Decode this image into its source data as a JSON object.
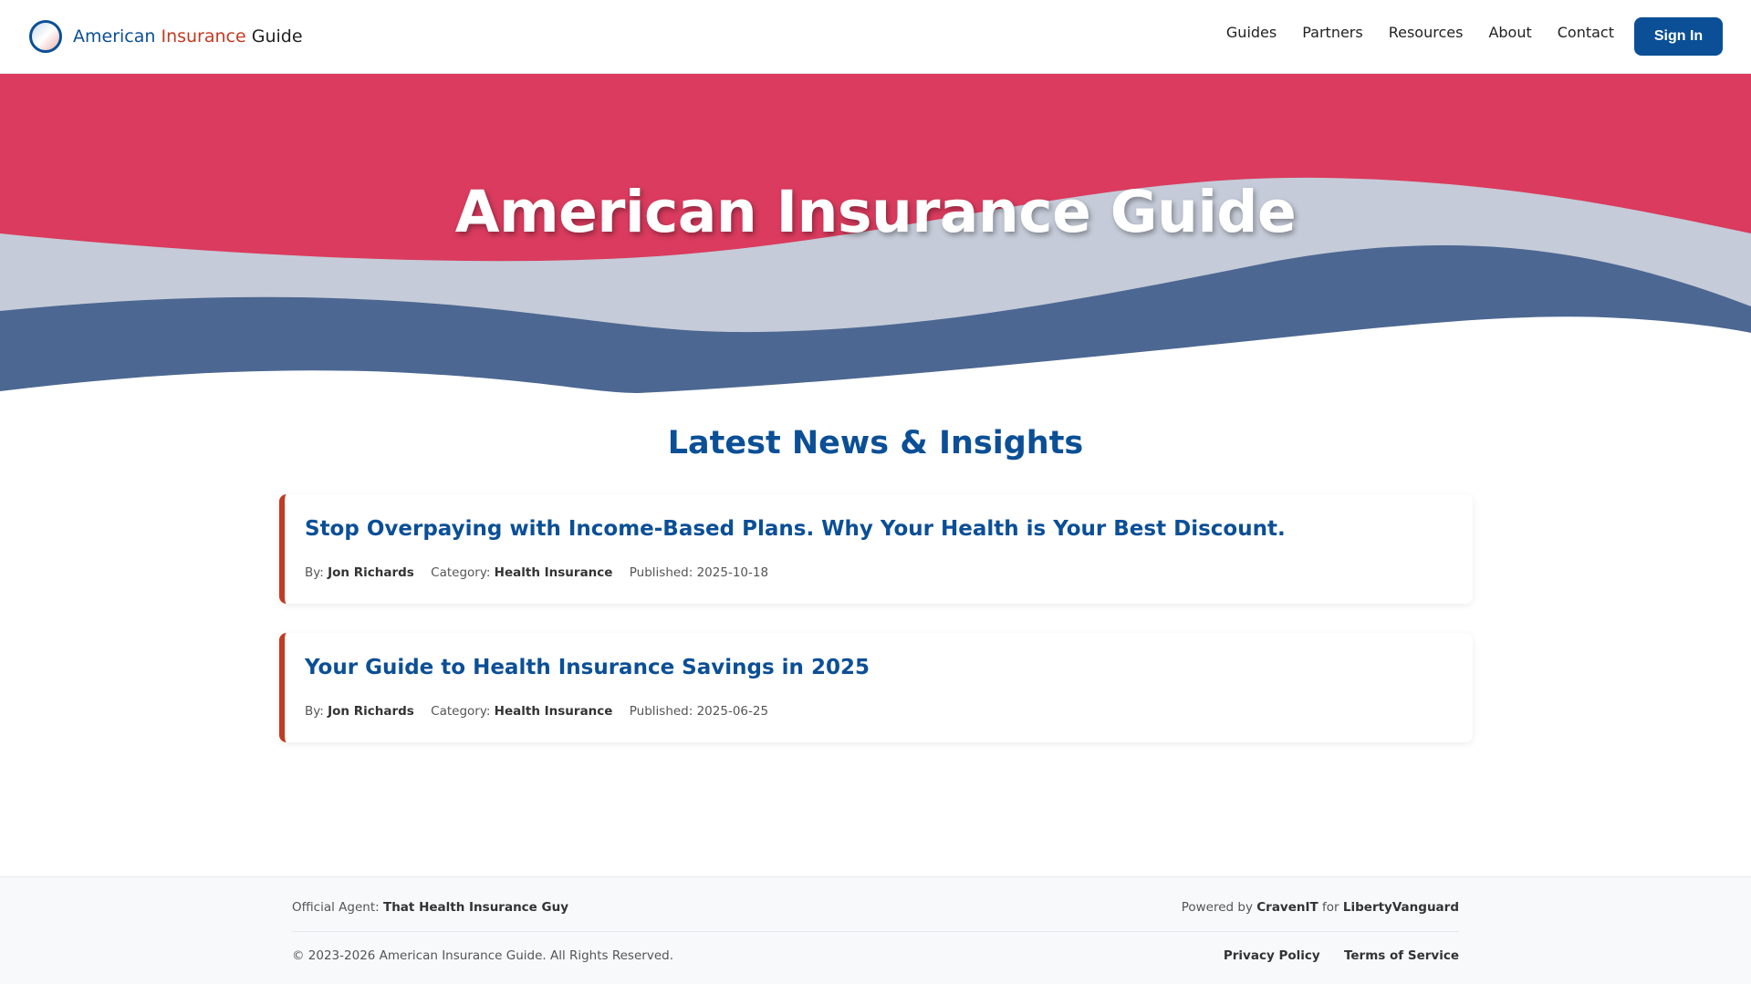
{
  "brand": {
    "word1": "American",
    "word2": "Insurance",
    "word3": "Guide",
    "colors": {
      "primary": "#0b4f96",
      "accent": "#c23a22",
      "hero_red": "#da3b5e",
      "hero_light": "#c5cbd8",
      "hero_blue": "#4c6792"
    }
  },
  "nav": {
    "items": [
      "Guides",
      "Partners",
      "Resources",
      "About",
      "Contact"
    ],
    "signin_label": "Sign In"
  },
  "hero": {
    "title": "American Insurance Guide"
  },
  "news": {
    "heading": "Latest News & Insights",
    "articles": [
      {
        "title": "Stop Overpaying with Income-Based Plans. Why Your Health is Your Best Discount.",
        "by_label": "By:",
        "author": "Jon Richards",
        "category_label": "Category:",
        "category": "Health Insurance",
        "published_label": "Published:",
        "published": "2025-10-18"
      },
      {
        "title": "Your Guide to Health Insurance Savings in 2025",
        "by_label": "By:",
        "author": "Jon Richards",
        "category_label": "Category:",
        "category": "Health Insurance",
        "published_label": "Published:",
        "published": "2025-06-25"
      }
    ]
  },
  "footer": {
    "agent_label": "Official Agent:",
    "agent_name": "That Health Insurance Guy",
    "powered_label": "Powered by",
    "powered_by": "CravenIT",
    "for_label": "for",
    "client": "LibertyVanguard",
    "copyright": "© 2023-2026 American Insurance Guide. All Rights Reserved.",
    "links": [
      "Privacy Policy",
      "Terms of Service"
    ]
  }
}
